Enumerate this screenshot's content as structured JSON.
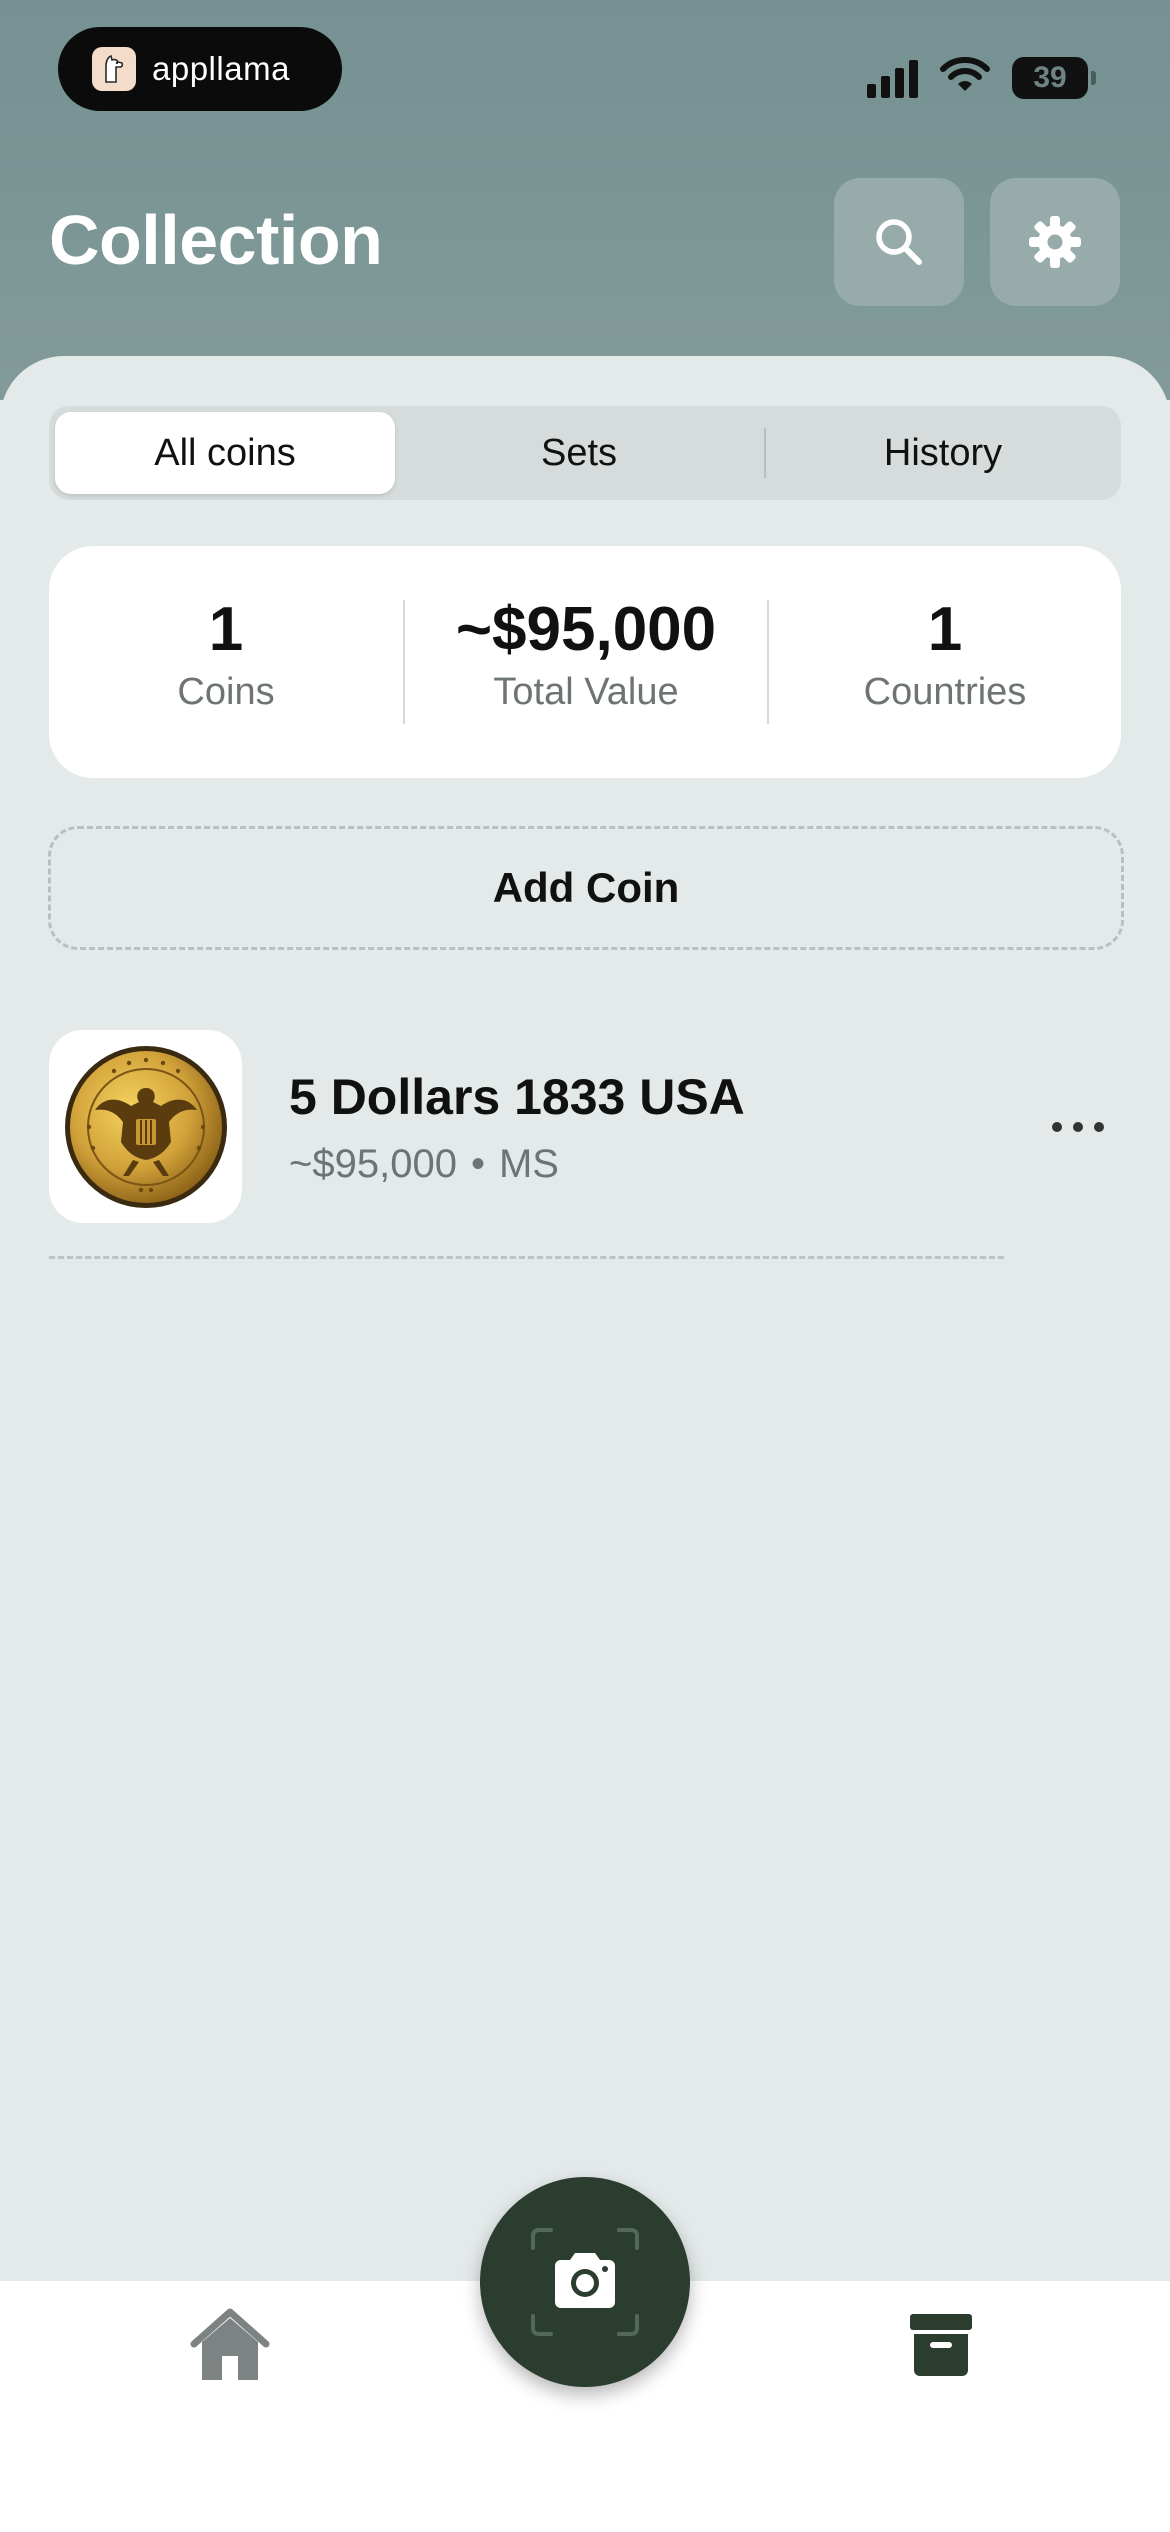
{
  "app": {
    "brand_name": "appllama",
    "battery_level": "39"
  },
  "header": {
    "title": "Collection",
    "search_icon": "search-icon",
    "settings_icon": "gear-icon"
  },
  "tabs": [
    {
      "label": "All coins",
      "active": true
    },
    {
      "label": "Sets",
      "active": false
    },
    {
      "label": "History",
      "active": false
    }
  ],
  "stats": {
    "coins": {
      "value": "1",
      "label": "Coins"
    },
    "total_value": {
      "value": "~$95,000",
      "label": "Total Value"
    },
    "countries": {
      "value": "1",
      "label": "Countries"
    }
  },
  "add_coin_label": "Add Coin",
  "coins": [
    {
      "name": "5 Dollars 1833 USA",
      "value": "~$95,000",
      "grade": "MS",
      "separator": "•"
    }
  ],
  "nav": {
    "home_icon": "home-icon",
    "scan_icon": "camera-icon",
    "collection_icon": "archive-box-icon"
  },
  "colors": {
    "header_bg": "#7b9696",
    "accent_dark_green": "#2a3d2f",
    "panel_bg": "#e4e9e9"
  }
}
